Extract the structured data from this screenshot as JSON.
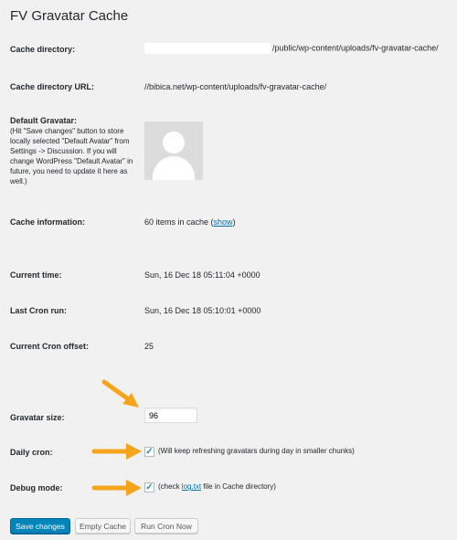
{
  "page": {
    "title": "FV Gravatar Cache"
  },
  "fields": {
    "cache_directory": {
      "label": "Cache directory:",
      "value": "/public/wp-content/uploads/fv-gravatar-cache/"
    },
    "cache_directory_url": {
      "label": "Cache directory URL:",
      "value": "//bibica.net/wp-content/uploads/fv-gravatar-cache/"
    },
    "default_gravatar": {
      "label": "Default Gravatar:",
      "help": "(Hit \"Save changes\" button to store locally selected \"Default Avatar\" from Settings -> Discussion. If you will change WordPress \"Default Avatar\" in future, you need to update it here as well.)"
    },
    "cache_information": {
      "label": "Cache information:",
      "prefix": "60 items in cache (",
      "link": "show",
      "suffix": ")"
    },
    "current_time": {
      "label": "Current time:",
      "value": "Sun, 16 Dec 18 05:11:04 +0000"
    },
    "last_cron_run": {
      "label": "Last Cron run:",
      "value": "Sun, 16 Dec 18 05:10:01 +0000"
    },
    "current_cron_offset": {
      "label": "Current Cron offset:",
      "value": "25"
    },
    "gravatar_size": {
      "label": "Gravatar size:",
      "value": "96"
    },
    "daily_cron": {
      "label": "Daily cron:",
      "checked": true,
      "text": "(Will keep refreshing gravatars during day in smaller chunks)"
    },
    "debug_mode": {
      "label": "Debug mode:",
      "checked": true,
      "prefix": "(check ",
      "link": "log.txt",
      "suffix": " file in Cache directory)"
    }
  },
  "buttons": {
    "save": "Save changes",
    "empty_cache": "Empty Cache",
    "run_cron": "Run Cron Now"
  },
  "colors": {
    "accent": "#0085ba",
    "link": "#0073aa",
    "arrow": "#f5a51c",
    "background": "#f1f1f1"
  },
  "icons": {
    "arrows": "arrow-icon",
    "checkbox": "checkmark-icon",
    "avatar": "default-avatar-icon"
  }
}
